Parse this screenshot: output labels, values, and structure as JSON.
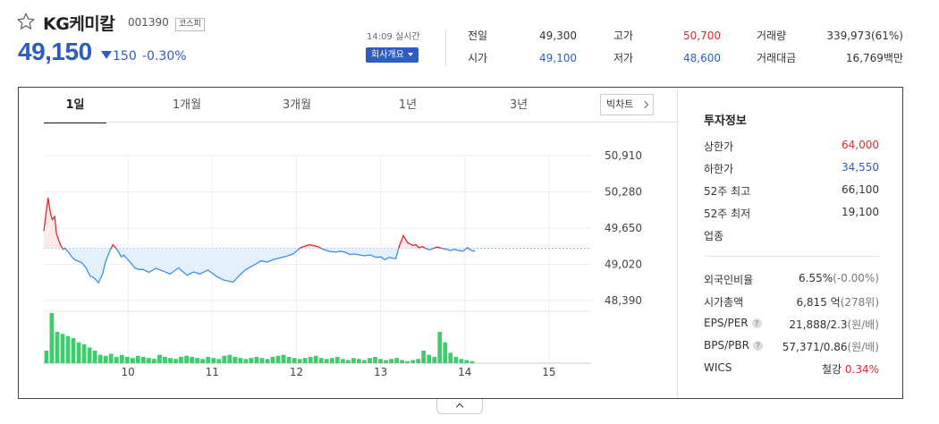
{
  "header": {
    "name": "KG케미칼",
    "code": "001390",
    "market": "코스피",
    "price": "49,150",
    "change_abs": "150",
    "change_pct": "-0.30%",
    "time": "14:09 실시간",
    "company_button": "회사개요"
  },
  "quote": [
    {
      "label": "전일",
      "value": "49,300",
      "color": "#333333"
    },
    {
      "label": "시가",
      "value": "49,100",
      "color": "#2d5dc1"
    },
    {
      "label": "고가",
      "value": "50,700",
      "color": "#e0282e"
    },
    {
      "label": "저가",
      "value": "48,600",
      "color": "#2d5dc1"
    },
    {
      "label": "거래량",
      "value": "339,973(61%)",
      "color": "#333333"
    },
    {
      "label": "거래대금",
      "value": "16,769백만",
      "color": "#333333"
    }
  ],
  "tabs": [
    "1일",
    "1개월",
    "3개월",
    "1년",
    "3년"
  ],
  "big_chart": "빅차트",
  "invest": {
    "title": "투자정보",
    "rows": [
      {
        "label": "상한가",
        "value": "64,000",
        "tone": "red"
      },
      {
        "label": "하한가",
        "value": "34,550",
        "tone": "blue"
      },
      {
        "label": "52주 최고",
        "value": "66,100",
        "tone": ""
      },
      {
        "label": "52주 최저",
        "value": "19,100",
        "tone": ""
      },
      {
        "label": "업종",
        "value": "",
        "tone": ""
      }
    ],
    "rows2": [
      {
        "label": "외국인비율",
        "value": "6.55%",
        "unit": "(-0.00%)",
        "help": false
      },
      {
        "label": "시가총액",
        "value": "6,815 억",
        "unit": "(278위)",
        "help": false
      },
      {
        "label": "EPS/PER",
        "value": "21,888/2.3",
        "unit": "(원/배)",
        "help": true
      },
      {
        "label": "BPS/PBR",
        "value": "57,371/0.86",
        "unit": "(원/배)",
        "help": true
      }
    ],
    "wics_label": "WICS",
    "wics_sector": "철강",
    "wics_pct": "0.34%"
  },
  "chart_data": {
    "type": "line",
    "y_ticks": [
      "50,910",
      "50,280",
      "49,650",
      "49,020",
      "48,390"
    ],
    "x_ticks": [
      "10",
      "11",
      "12",
      "13",
      "14",
      "15"
    ],
    "ylim": [
      48390,
      50910
    ],
    "x_range": [
      9.0,
      15.5
    ],
    "baseline": 49300,
    "up_color": "#e0282e",
    "down_color": "#3d8fe8",
    "volume_color": "#3fcc6c",
    "price": {
      "x": [
        9.0,
        9.05,
        9.08,
        9.1,
        9.13,
        9.15,
        9.2,
        9.23,
        9.25,
        9.3,
        9.33,
        9.37,
        9.45,
        9.5,
        9.55,
        9.6,
        9.65,
        9.7,
        9.73,
        9.78,
        9.82,
        9.87,
        9.92,
        9.95,
        10.0,
        10.03,
        10.08,
        10.13,
        10.18,
        10.25,
        10.33,
        10.42,
        10.5,
        10.6,
        10.7,
        10.78,
        10.85,
        10.95,
        11.05,
        11.13,
        11.25,
        11.33,
        11.4,
        11.5,
        11.58,
        11.65,
        11.72,
        11.8,
        11.88,
        11.96,
        12.05,
        12.15,
        12.25,
        12.32,
        12.38,
        12.42,
        12.47,
        12.52,
        12.58,
        12.63,
        12.68,
        12.73,
        12.8,
        12.88,
        12.95,
        13.0,
        13.05,
        13.1,
        13.13,
        13.18,
        13.22,
        13.27,
        13.32,
        13.38,
        13.42,
        13.45,
        13.5,
        13.53,
        13.58,
        13.63,
        13.68,
        13.72,
        13.78,
        13.83,
        13.88,
        13.93,
        13.98,
        14.03,
        14.08,
        14.12
      ],
      "y": [
        49600,
        50180,
        49900,
        49800,
        49850,
        49550,
        49350,
        49280,
        49300,
        49220,
        49150,
        49100,
        49050,
        48960,
        48820,
        48780,
        48700,
        48860,
        49050,
        49240,
        49360,
        49280,
        49150,
        49180,
        49100,
        49050,
        48960,
        48930,
        48930,
        48880,
        48950,
        48900,
        48850,
        48960,
        48830,
        48890,
        48850,
        48920,
        48810,
        48750,
        48710,
        48840,
        48930,
        49010,
        49080,
        49060,
        49100,
        49130,
        49160,
        49200,
        49310,
        49360,
        49330,
        49280,
        49250,
        49240,
        49230,
        49250,
        49230,
        49190,
        49200,
        49190,
        49170,
        49180,
        49140,
        49150,
        49100,
        49140,
        49130,
        49120,
        49330,
        49520,
        49400,
        49350,
        49360,
        49310,
        49330,
        49300,
        49270,
        49300,
        49320,
        49300,
        49280,
        49260,
        49280,
        49260,
        49250,
        49310,
        49260,
        49250
      ]
    },
    "volume": [
      120,
      480,
      300,
      280,
      260,
      240,
      200,
      180,
      150,
      120,
      80,
      70,
      90,
      60,
      80,
      60,
      50,
      70,
      60,
      50,
      40,
      80,
      60,
      50,
      40,
      60,
      70,
      60,
      50,
      40,
      60,
      50,
      40,
      70,
      80,
      60,
      50,
      40,
      50,
      60,
      50,
      40,
      60,
      70,
      80,
      60,
      50,
      40,
      50,
      60,
      70,
      50,
      40,
      50,
      60,
      40,
      30,
      50,
      40,
      30,
      50,
      60,
      40,
      30,
      40,
      50,
      30,
      20,
      30,
      40,
      120,
      80,
      60,
      300,
      200,
      100,
      60,
      40,
      30,
      20
    ]
  }
}
